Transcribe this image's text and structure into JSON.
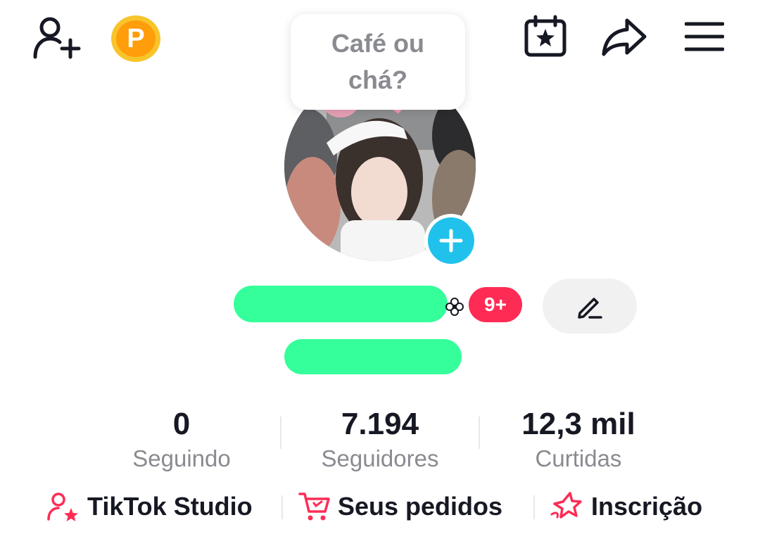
{
  "header": {
    "icons": {
      "add_friend": "add-user-icon",
      "coin": "coin-icon",
      "calendar": "calendar-star-icon",
      "share": "share-icon",
      "menu": "menu-icon"
    },
    "coin_letter": "P"
  },
  "profile": {
    "note_bubble": "Café ou chá?",
    "notifications_badge": "9+",
    "edit_icon": "pencil-icon",
    "add_photo_icon": "plus-icon"
  },
  "stats": [
    {
      "value": "0",
      "label": "Seguindo"
    },
    {
      "value": "7.194",
      "label": "Seguidores"
    },
    {
      "value": "12,3 mil",
      "label": "Curtidas"
    }
  ],
  "links": [
    {
      "label": "TikTok Studio",
      "icon": "user-star-icon"
    },
    {
      "label": "Seus pedidos",
      "icon": "cart-icon"
    },
    {
      "label": "Inscrição",
      "icon": "star-outline-icon"
    }
  ],
  "colors": {
    "accent": "#fe2c55",
    "blue": "#20c2ec",
    "coin_outer": "#f7c52b",
    "coin_inner": "#ff9d0a",
    "redaction": "#34ff9a",
    "muted_text": "#8a8b91"
  }
}
